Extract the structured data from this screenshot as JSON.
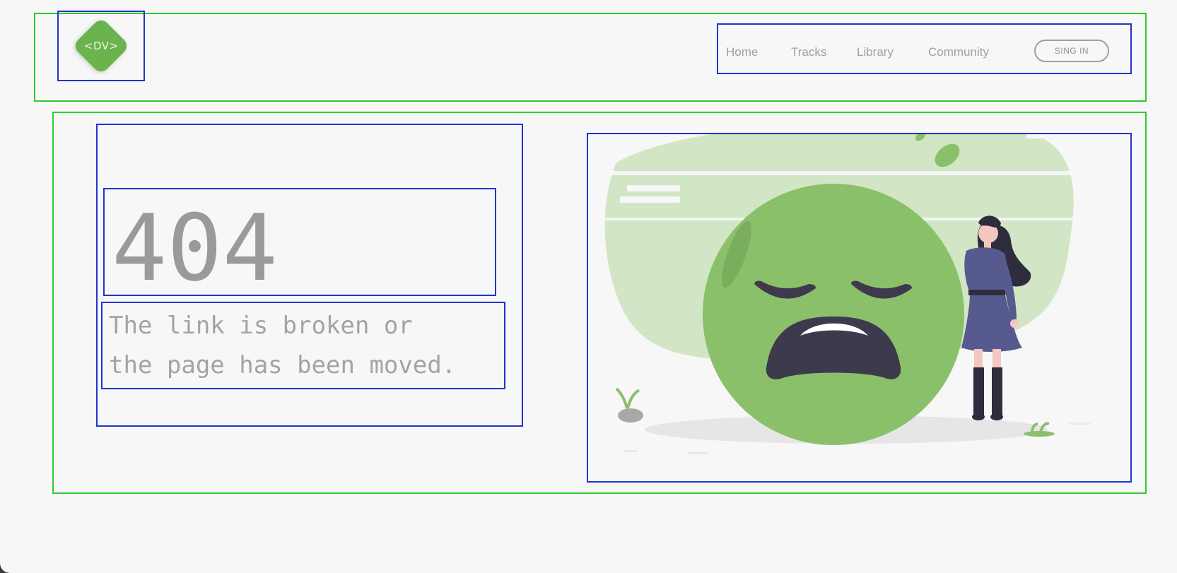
{
  "brand": {
    "logo_text": "<DV>",
    "accent_color": "#6bb34e"
  },
  "nav": {
    "links": [
      "Home",
      "Tracks",
      "Library",
      "Community"
    ],
    "signin_label": "SING IN"
  },
  "error": {
    "code": "404",
    "message": "The link is broken or\nthe page has been moved."
  },
  "illustration": {
    "icon": "sad-emoji-with-woman-illustration",
    "colors": {
      "face": "#8bc06b",
      "background_blob": "#d2e6c6",
      "features": "#3e3a4e",
      "dress": "#575a8e"
    }
  }
}
